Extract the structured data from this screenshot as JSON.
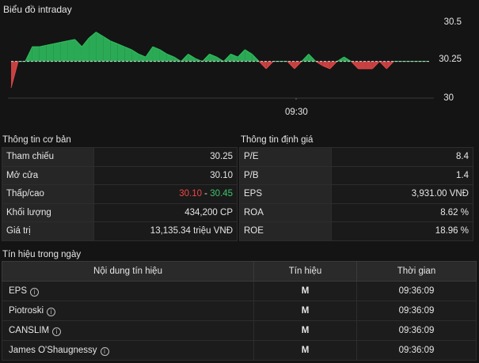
{
  "chart": {
    "title": "Biểu đồ intraday",
    "y_ticks": [
      "30.5",
      "30.25",
      "30"
    ],
    "x_ticks": [
      "09:30"
    ],
    "colors": {
      "up": "#2fbf5f",
      "down": "#e04848",
      "reference": "#d9d9d9"
    }
  },
  "chart_data": {
    "type": "area",
    "reference": 30.25,
    "ylim": [
      30.0,
      30.55
    ],
    "x_label": "09:30",
    "values": [
      30.07,
      30.25,
      30.25,
      30.35,
      30.35,
      30.36,
      30.37,
      30.38,
      30.39,
      30.4,
      30.35,
      30.41,
      30.45,
      30.42,
      30.39,
      30.37,
      30.35,
      30.33,
      30.3,
      30.28,
      30.35,
      30.33,
      30.3,
      30.28,
      30.25,
      30.3,
      30.27,
      30.25,
      30.3,
      30.28,
      30.25,
      30.3,
      30.28,
      30.33,
      30.3,
      30.25,
      30.2,
      30.25,
      30.25,
      30.25,
      30.2,
      30.25,
      30.3,
      30.25,
      30.22,
      30.2,
      30.25,
      30.28,
      30.25,
      30.2,
      30.2,
      30.2,
      30.25,
      30.2,
      30.25,
      30.25,
      30.25,
      30.25,
      30.25,
      30.25
    ]
  },
  "basic": {
    "title": "Thông tin cơ bản",
    "rows": [
      {
        "label": "Tham chiếu",
        "value": "30.25"
      },
      {
        "label": "Mở cửa",
        "value": "30.10"
      },
      {
        "label": "Thấp/cao",
        "low": "30.10",
        "sep": " - ",
        "high": "30.45"
      },
      {
        "label": "Khối lượng",
        "value": "434,200 CP"
      },
      {
        "label": "Giá trị",
        "value": "13,135.34 triệu VNĐ"
      }
    ]
  },
  "valuation": {
    "title": "Thông tin định giá",
    "rows": [
      {
        "label": "P/E",
        "value": "8.4"
      },
      {
        "label": "P/B",
        "value": "1.4"
      },
      {
        "label": "EPS",
        "value": "3,931.00 VNĐ"
      },
      {
        "label": "ROA",
        "value": "8.62 %"
      },
      {
        "label": "ROE",
        "value": "18.96 %"
      }
    ]
  },
  "signals": {
    "title": "Tín hiệu trong ngày",
    "headers": [
      "Nội dung tín hiệu",
      "Tín hiệu",
      "Thời gian"
    ],
    "rows": [
      {
        "name": "EPS",
        "signal": "M",
        "time": "09:36:09"
      },
      {
        "name": "Piotroski",
        "signal": "M",
        "time": "09:36:09"
      },
      {
        "name": "CANSLIM",
        "signal": "M",
        "time": "09:36:09"
      },
      {
        "name": "James O'Shaugnessy",
        "signal": "M",
        "time": "09:36:09"
      }
    ],
    "info_icon": "i"
  }
}
